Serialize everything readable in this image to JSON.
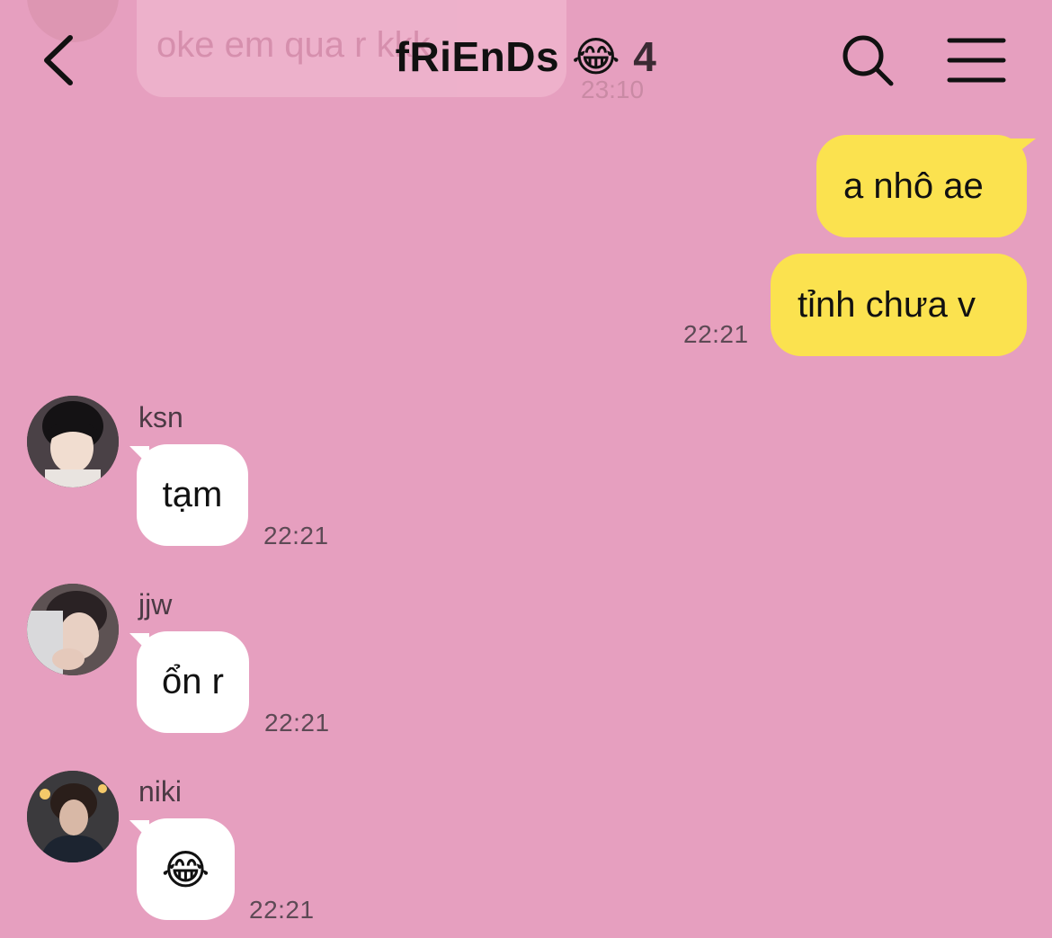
{
  "header": {
    "title": "fRiEnDs",
    "title_emoji": "😂",
    "member_count": "4",
    "back_icon": "chevron-left-icon",
    "search_icon": "search-icon",
    "menu_icon": "hamburger-menu-icon"
  },
  "background_message": {
    "text": "oke em qua r kkk",
    "time": "23:10"
  },
  "colors": {
    "background": "#e69fbf",
    "outgoing_bubble": "#fbe24f",
    "incoming_bubble": "#ffffff"
  },
  "messages": {
    "out1": {
      "text": "a nhô ae"
    },
    "out2": {
      "text": "tỉnh chưa v",
      "time": "22:21"
    },
    "ksn": {
      "sender": "ksn",
      "text": "tạm",
      "time": "22:21"
    },
    "jjw": {
      "sender": "jjw",
      "text": "ổn r",
      "time": "22:21"
    },
    "niki": {
      "sender": "niki",
      "text": "😂",
      "time": "22:21"
    }
  }
}
